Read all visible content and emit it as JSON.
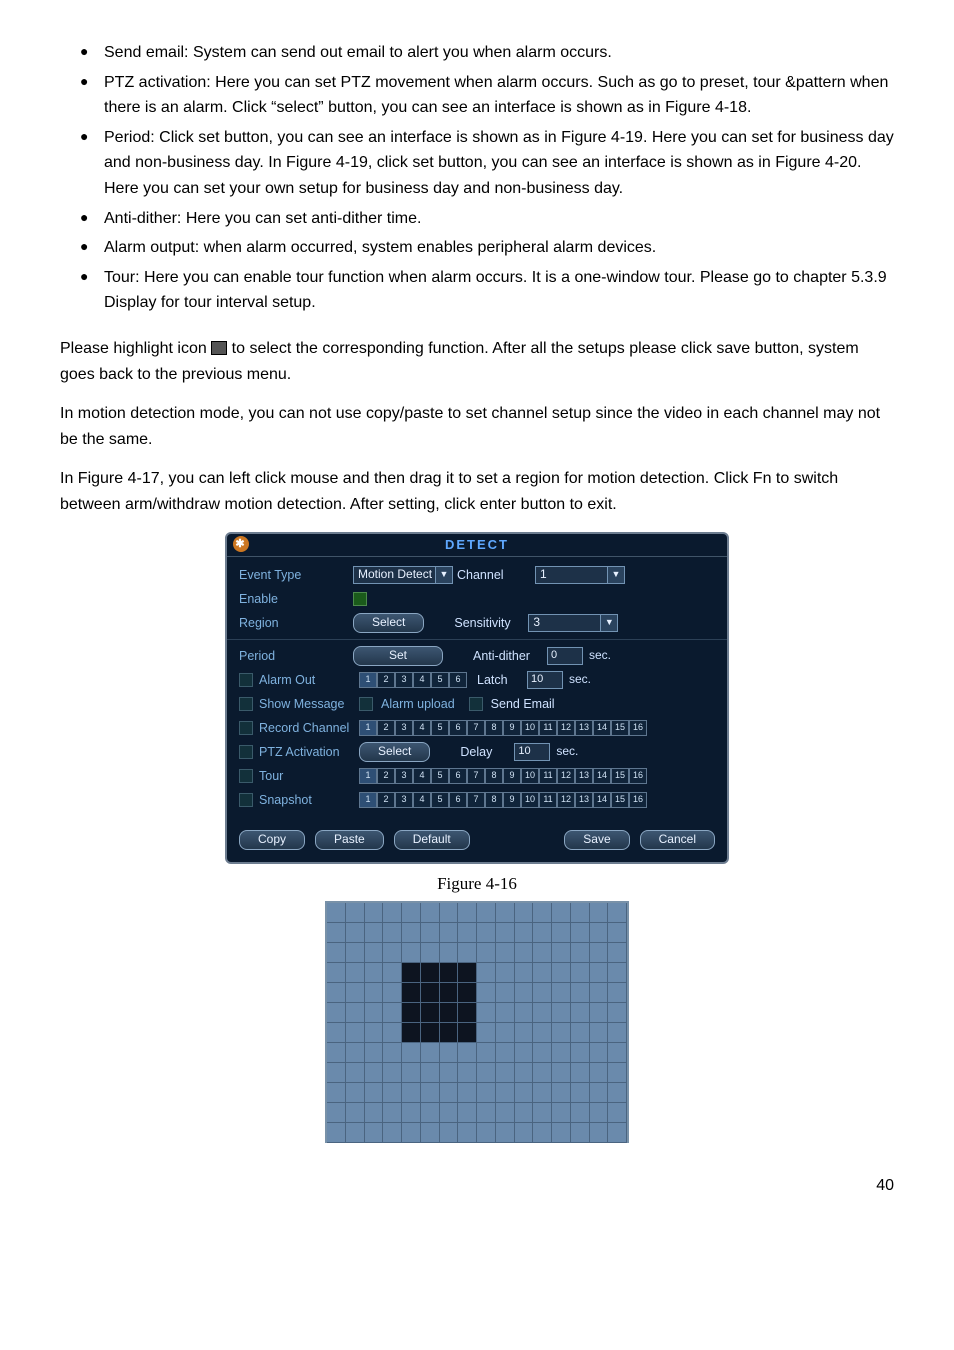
{
  "bullets": [
    "Send email: System can send out email to alert you when alarm occurs.",
    "PTZ activation: Here you can set PTZ movement when alarm occurs. Such as go to preset, tour &pattern when there is an alarm. Click “select” button, you can see an interface is shown as in Figure 4-18.",
    "Period: Click set button, you can see an interface is shown as in Figure 4-19. Here you can set for business day and non-business day. In Figure 4-19, click set button, you can see an interface is shown as in Figure 4-20. Here you can set your own setup for business day and non-business day.",
    "Anti-dither: Here you can set anti-dither time.",
    "Alarm output: when alarm occurred, system enables peripheral alarm devices.",
    "Tour: Here you can enable tour function when alarm occurs.  It is a one-window tour. Please go to chapter 5.3.9 Display for tour interval setup."
  ],
  "para1a": "Please highlight icon ",
  "para1b": " to select the corresponding function. After all the setups please click save button, system goes back to the previous menu.",
  "para2": "In motion detection mode, you can not use copy/paste to set channel setup since the video in each channel may not be the same.",
  "para3": "In Figure 4-17, you can left click mouse and then drag it to set a region for motion detection. Click Fn to switch between arm/withdraw motion detection. After setting, click enter button to exit.",
  "detect": {
    "header": "DETECT",
    "eventTypeLabel": "Event Type",
    "eventTypeValue": "Motion Detect",
    "channelLabel": "Channel",
    "channelValue": "1",
    "enableLabel": "Enable",
    "regionLabel": "Region",
    "selectBtn": "Select",
    "sensitivityLabel": "Sensitivity",
    "sensitivityValue": "3",
    "periodLabel": "Period",
    "setBtn": "Set",
    "antiDitherLabel": "Anti-dither",
    "antiDitherValue": "0",
    "sec": "sec.",
    "alarmOutLabel": "Alarm Out",
    "alarmChannels": [
      "1",
      "2",
      "3",
      "4",
      "5",
      "6"
    ],
    "latchLabel": "Latch",
    "latchValue": "10",
    "showMessage": "Show Message",
    "alarmUpload": "Alarm upload",
    "sendEmail": "Send Email",
    "recordChannel": "Record Channel",
    "channels16": [
      "1",
      "2",
      "3",
      "4",
      "5",
      "6",
      "7",
      "8",
      "9",
      "10",
      "11",
      "12",
      "13",
      "14",
      "15",
      "16"
    ],
    "ptzActivation": "PTZ Activation",
    "delayLabel": "Delay",
    "delayValue": "10",
    "tour": "Tour",
    "snapshot": "Snapshot",
    "copy": "Copy",
    "paste": "Paste",
    "default": "Default",
    "save": "Save",
    "cancel": "Cancel"
  },
  "figureCaption": "Figure 4-16",
  "regionGrid": {
    "rows": 12,
    "cols": 16,
    "selected": [
      [
        3,
        4
      ],
      [
        3,
        5
      ],
      [
        3,
        6
      ],
      [
        3,
        7
      ],
      [
        4,
        4
      ],
      [
        4,
        5
      ],
      [
        4,
        6
      ],
      [
        4,
        7
      ],
      [
        5,
        4
      ],
      [
        5,
        5
      ],
      [
        5,
        6
      ],
      [
        5,
        7
      ],
      [
        6,
        4
      ],
      [
        6,
        5
      ],
      [
        6,
        6
      ],
      [
        6,
        7
      ]
    ]
  },
  "pageNumber": "40",
  "chart_data": {
    "type": "table",
    "title": "DETECT configuration panel",
    "fields": [
      {
        "name": "Event Type",
        "value": "Motion Detect"
      },
      {
        "name": "Channel",
        "value": 1
      },
      {
        "name": "Enable",
        "value": true
      },
      {
        "name": "Region",
        "value": "Select"
      },
      {
        "name": "Sensitivity",
        "value": 3
      },
      {
        "name": "Period",
        "value": "Set"
      },
      {
        "name": "Anti-dither",
        "value": 0,
        "unit": "sec."
      },
      {
        "name": "Alarm Out",
        "channels": [
          1,
          2,
          3,
          4,
          5,
          6
        ],
        "selected": [
          1
        ]
      },
      {
        "name": "Latch",
        "value": 10,
        "unit": "sec."
      },
      {
        "name": "Show Message",
        "value": false
      },
      {
        "name": "Alarm upload",
        "value": false
      },
      {
        "name": "Send Email",
        "value": false
      },
      {
        "name": "Record Channel",
        "channels": [
          1,
          2,
          3,
          4,
          5,
          6,
          7,
          8,
          9,
          10,
          11,
          12,
          13,
          14,
          15,
          16
        ],
        "selected": [
          1
        ]
      },
      {
        "name": "PTZ Activation",
        "value": "Select"
      },
      {
        "name": "Delay",
        "value": 10,
        "unit": "sec."
      },
      {
        "name": "Tour",
        "channels": [
          1,
          2,
          3,
          4,
          5,
          6,
          7,
          8,
          9,
          10,
          11,
          12,
          13,
          14,
          15,
          16
        ],
        "selected": [
          1
        ]
      },
      {
        "name": "Snapshot",
        "channels": [
          1,
          2,
          3,
          4,
          5,
          6,
          7,
          8,
          9,
          10,
          11,
          12,
          13,
          14,
          15,
          16
        ],
        "selected": [
          1
        ]
      }
    ]
  }
}
